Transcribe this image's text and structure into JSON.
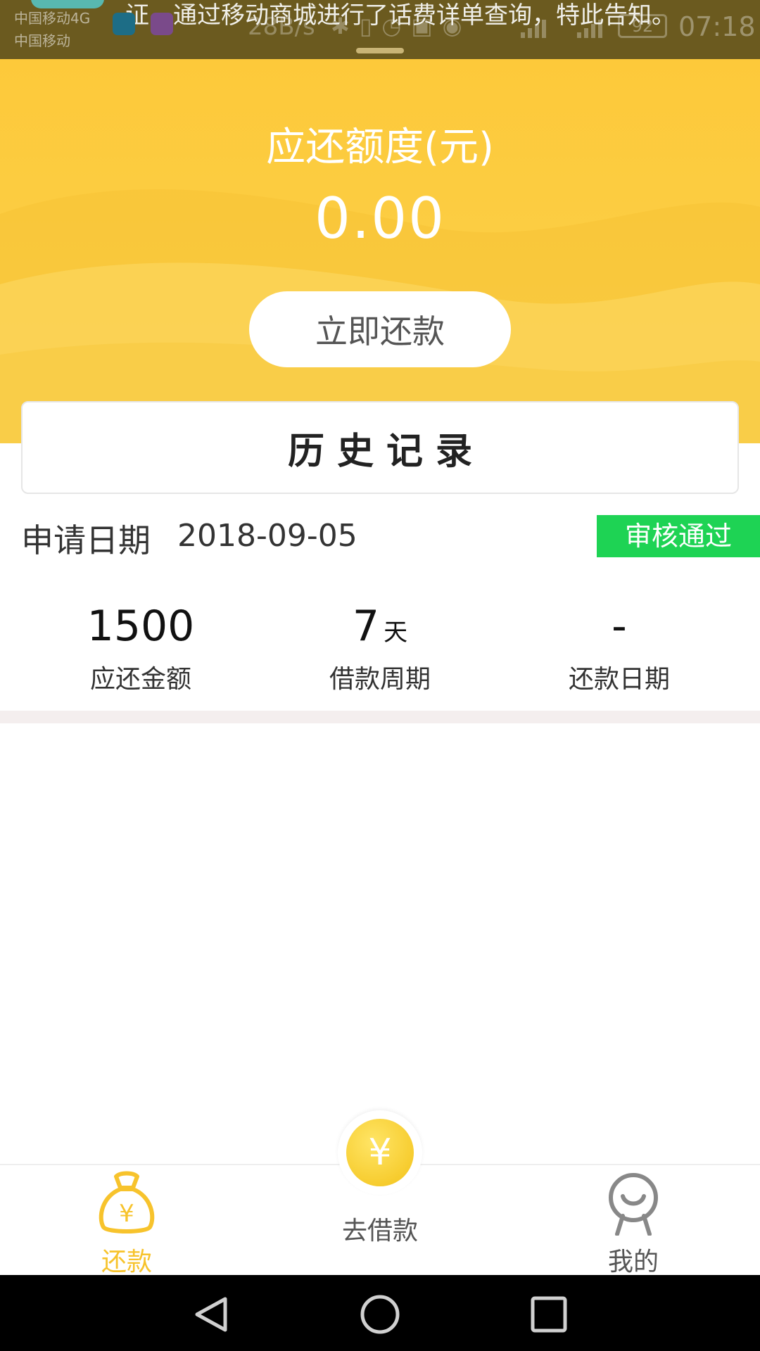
{
  "status_bar": {
    "notification_text": "证，通过移动商城进行了话费详单查询，特此告知。",
    "carrier_1": "中国移动4G",
    "carrier_2": "中国移动",
    "net_speed": "28B/s",
    "battery": "92",
    "time": "07:18"
  },
  "hero": {
    "title": "应还额度(元)",
    "amount": "0.00",
    "repay_button": "立即还款"
  },
  "history": {
    "title": "历史记录"
  },
  "record": {
    "date_label": "申请日期",
    "date_value": "2018-09-05",
    "status": "审核通过",
    "amount_value": "1500",
    "amount_label": "应还金额",
    "period_value": "7",
    "period_unit": "天",
    "period_label": "借款周期",
    "repay_date_value": "-",
    "repay_date_label": "还款日期"
  },
  "bottom_nav": {
    "repay": "还款",
    "borrow": "去借款",
    "borrow_symbol": "¥",
    "mine": "我的"
  },
  "colors": {
    "accent": "#fdc93a",
    "status_green": "#1ed354"
  }
}
